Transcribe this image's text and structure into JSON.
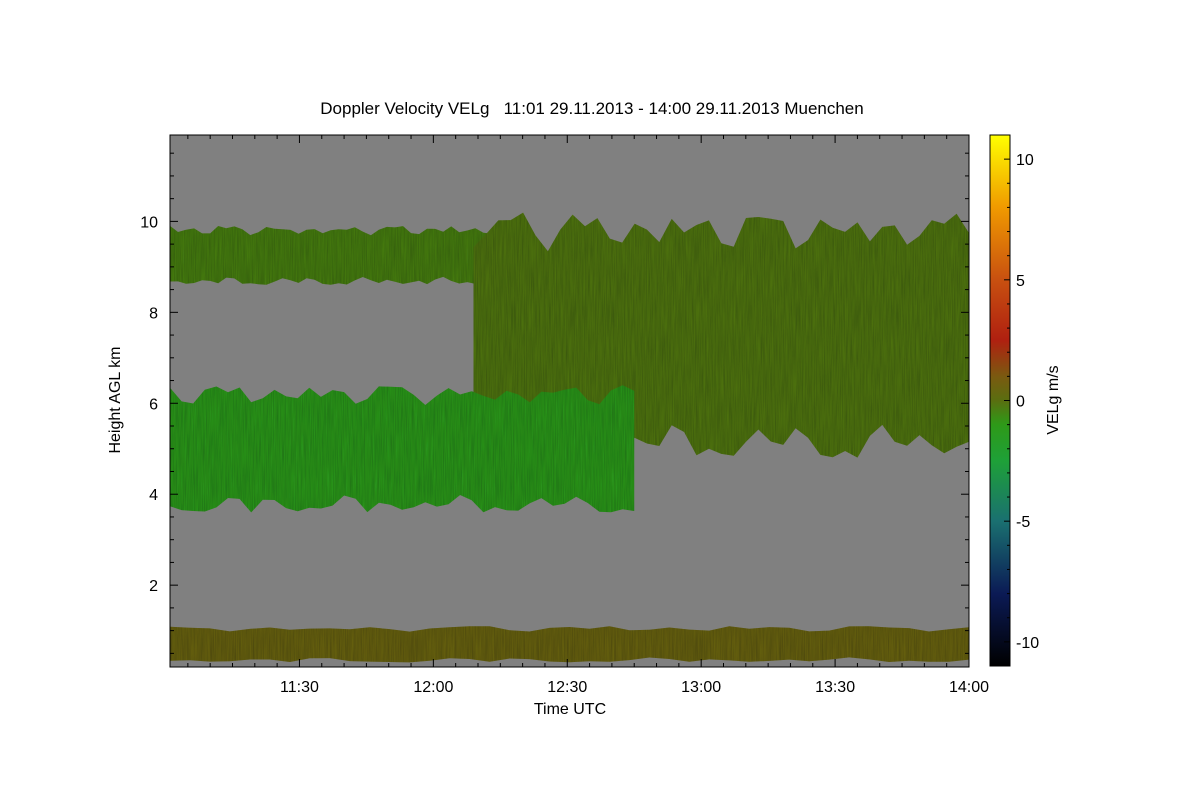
{
  "chart_data": {
    "type": "heatmap",
    "title": "Doppler Velocity VELg   11:01 29.11.2013 - 14:00 29.11.2013 Muenchen",
    "xlabel": "Time UTC",
    "ylabel": "Height AGL km",
    "colorbar_label": "VELg m/s",
    "x_range": [
      "11:01",
      "14:00"
    ],
    "y_range_km": [
      0.2,
      11.9
    ],
    "x_ticks": [
      {
        "label": "11:30",
        "minutes": 29
      },
      {
        "label": "12:00",
        "minutes": 59
      },
      {
        "label": "12:30",
        "minutes": 89
      },
      {
        "label": "13:00",
        "minutes": 119
      },
      {
        "label": "13:30",
        "minutes": 149
      },
      {
        "label": "14:00",
        "minutes": 179
      }
    ],
    "y_ticks": [
      2,
      4,
      6,
      8,
      10
    ],
    "colorbar_range": [
      -11,
      11
    ],
    "colorbar_ticks": [
      10,
      5,
      0,
      -5,
      -10
    ],
    "colorscale": [
      {
        "v": -11,
        "color": "#000000"
      },
      {
        "v": -8,
        "color": "#0b1a55"
      },
      {
        "v": -5,
        "color": "#1a7070"
      },
      {
        "v": -2.5,
        "color": "#1ea038"
      },
      {
        "v": -1,
        "color": "#2e9a18"
      },
      {
        "v": 0,
        "color": "#5a6e10"
      },
      {
        "v": 1,
        "color": "#7a5a10"
      },
      {
        "v": 2.5,
        "color": "#b02010"
      },
      {
        "v": 5,
        "color": "#c85010"
      },
      {
        "v": 8,
        "color": "#f09a00"
      },
      {
        "v": 11,
        "color": "#ffff00"
      }
    ],
    "background_color": "#808080",
    "regions": [
      {
        "name": "upper cloud layer left",
        "t_start": 0,
        "t_end": 72,
        "h_bottom": 8.6,
        "h_top": 9.9,
        "mean_velocity": -0.4
      },
      {
        "name": "upper cloud layer right",
        "t_start": 68,
        "t_end": 179,
        "h_bottom": 4.8,
        "h_top": 10.2,
        "mean_velocity": -0.2
      },
      {
        "name": "mid cloud layer",
        "t_start": 0,
        "t_end": 104,
        "h_bottom": 3.6,
        "h_top": 6.4,
        "mean_velocity": -1.2
      },
      {
        "name": "boundary layer",
        "t_start": 0,
        "t_end": 179,
        "h_bottom": 0.3,
        "h_top": 1.1,
        "mean_velocity": 0.5
      }
    ]
  }
}
